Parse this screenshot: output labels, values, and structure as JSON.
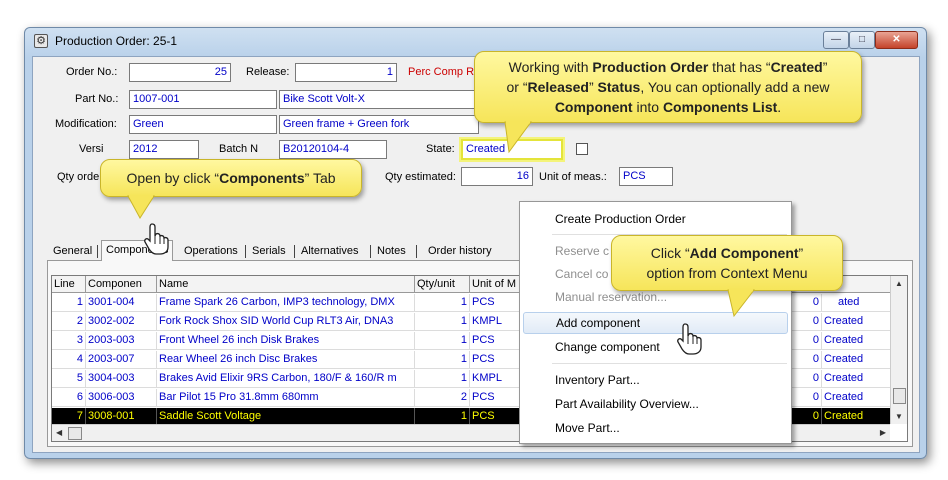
{
  "window": {
    "title": "Production Order: 25-1",
    "min_glyph": "—",
    "max_glyph": "□",
    "close_glyph": "✕"
  },
  "form": {
    "order_no_label": "Order No.:",
    "order_no": "25",
    "release_label": "Release:",
    "release": "1",
    "perc_comp_label": "Perc Comp Res",
    "part_no_label": "Part No.:",
    "part_no": "1007-001",
    "part_desc": "Bike Scott Volt-X",
    "modification_label": "Modification:",
    "modification": "Green",
    "modification_desc": "Green frame + Green fork",
    "version_label": "Versi",
    "version": "2012",
    "batch_label": "Batch N",
    "batch": "B20120104-4",
    "state_label": "State:",
    "state": "Created",
    "qty_order_label": "Qty orde",
    "qty_estimated_label": "Qty estimated:",
    "qty_estimated": "16",
    "unit_label": "Unit of meas.:",
    "unit": "PCS"
  },
  "tabs": [
    {
      "label": "General"
    },
    {
      "label": "Components"
    },
    {
      "label": "Operations"
    },
    {
      "label": "Serials"
    },
    {
      "label": "Alternatives"
    },
    {
      "label": "Notes"
    },
    {
      "label": "Order history"
    }
  ],
  "grid": {
    "columns": [
      "Line",
      "Componen",
      "Name",
      "Qty/unit",
      "Unit of M",
      "e"
    ],
    "rows": [
      {
        "line": "1",
        "component": "3001-004",
        "name": "Frame Spark 26 Carbon, IMP3 technology, DMX",
        "qty": "1",
        "unit": "PCS",
        "qty2": "0",
        "status": "Created"
      },
      {
        "line": "2",
        "component": "3002-002",
        "name": "Fork Rock Shox SID World Cup RLT3 Air, DNA3",
        "qty": "1",
        "unit": "KMPL",
        "qty2": "0",
        "status": "Created"
      },
      {
        "line": "3",
        "component": "2003-003",
        "name": "Front Wheel 26 inch Disk Brakes",
        "qty": "1",
        "unit": "PCS",
        "qty2": "0",
        "status": "Created"
      },
      {
        "line": "4",
        "component": "2003-007",
        "name": "Rear Wheel 26 inch Disc Brakes",
        "qty": "1",
        "unit": "PCS",
        "qty2": "0",
        "status": "Created"
      },
      {
        "line": "5",
        "component": "3004-003",
        "name": "Brakes Avid Elixir 9RS Carbon, 180/F & 160/R m",
        "qty": "1",
        "unit": "KMPL",
        "qty2": "0",
        "status": "Created"
      },
      {
        "line": "6",
        "component": "3006-003",
        "name": "Bar Pilot 15 Pro 31.8mm 680mm",
        "qty": "2",
        "unit": "PCS",
        "qty2": "0",
        "status": "Created"
      },
      {
        "line": "7",
        "component": "3008-001",
        "name": "Saddle Scott Voltage",
        "qty": "1",
        "unit": "PCS",
        "qty2": "0",
        "status": "Created"
      }
    ],
    "row1_status_partial": "ated"
  },
  "context_menu": {
    "items": [
      {
        "label": "Create Production Order",
        "state": "enabled"
      },
      {
        "label": "Reserve c",
        "state": "disabled"
      },
      {
        "label": "Cancel co",
        "state": "disabled"
      },
      {
        "label": "Manual reservation...",
        "state": "disabled"
      },
      {
        "label": "Add component",
        "state": "highlighted"
      },
      {
        "label": "Change component",
        "state": "enabled"
      },
      {
        "label": "Inventory Part...",
        "state": "enabled"
      },
      {
        "label": "Part Availability Overview...",
        "state": "enabled"
      },
      {
        "label": "Move Part...",
        "state": "enabled"
      }
    ]
  },
  "callouts": {
    "top": {
      "line1_a": "Working with ",
      "line1_b": "Production Order",
      "line1_c": " that has “",
      "line1_d": "Created",
      "line1_e": "”",
      "line2_a": "or “",
      "line2_b": "Released",
      "line2_c": "” ",
      "line2_d": "Status",
      "line2_e": ", You can optionally add a new",
      "line3_a": "Component",
      "line3_b": " into ",
      "line3_c": "Components List",
      "line3_d": "."
    },
    "left": {
      "a": "Open by click “",
      "b": "Components",
      "c": "” Tab"
    },
    "right": {
      "line1_a": "Click “",
      "line1_b": "Add Component",
      "line1_c": "”",
      "line2": "option from Context Menu"
    }
  },
  "colors": {
    "field_text": "#0000c8",
    "perc_label": "#cc0000",
    "selected_row_bg": "#000000",
    "selected_row_text": "#ffff00",
    "callout_fill": "#f6e55a"
  }
}
